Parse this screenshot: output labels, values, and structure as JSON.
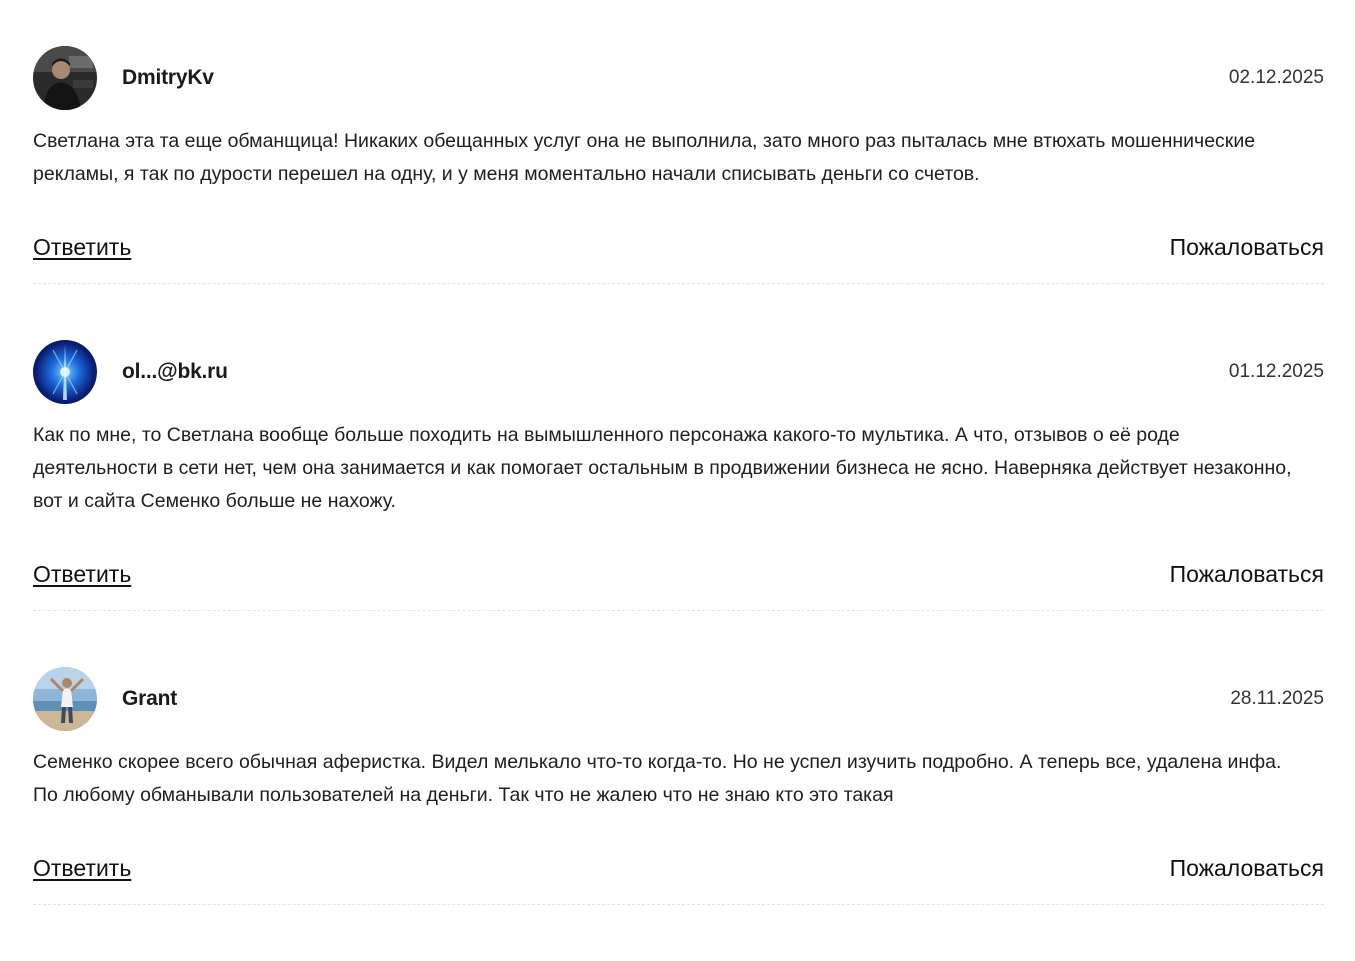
{
  "comments": [
    {
      "username": "DmitryKv",
      "date": "02.12.2025",
      "text": "Светлана эта та еще обманщица! Никаких обещанных услуг она не выполнила, зато много раз пыталась мне втюхать мошеннические рекламы, я так по дурости перешел на одну, и у меня моментально начали списывать деньги со счетов.",
      "reply_label": "Ответить",
      "report_label": "Пожаловаться"
    },
    {
      "username": "ol...@bk.ru",
      "date": "01.12.2025",
      "text": "Как по мне, то Светлана вообще больше походить на вымышленного персонажа какого-то мультика. А что, отзывов о её роде деятельности в сети нет, чем она занимается и как помогает остальным в продвижении бизнеса не ясно. Наверняка действует незаконно, вот и сайта Семенко больше не нахожу.",
      "reply_label": "Ответить",
      "report_label": "Пожаловаться"
    },
    {
      "username": "Grant",
      "date": "28.11.2025",
      "text": "Семенко скорее всего обычная аферистка. Видел мелькало что-то когда-то. Но не успел изучить подробно. А теперь все, удалена инфа. По любому обманывали пользователей на деньги. Так что не жалею что не знаю кто это такая",
      "reply_label": "Ответить",
      "report_label": "Пожаловаться"
    }
  ],
  "colors": {
    "text": "#1a1a1a",
    "divider": "#e3e3e3",
    "background": "#ffffff"
  }
}
